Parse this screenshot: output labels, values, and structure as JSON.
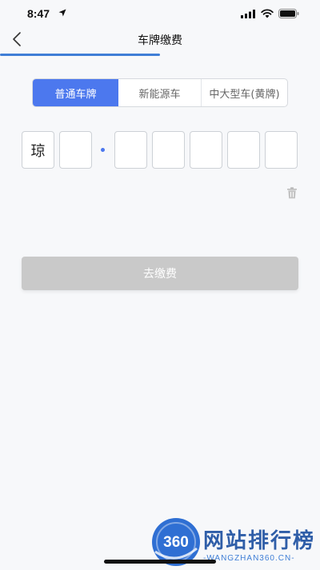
{
  "status_bar": {
    "time": "8:47"
  },
  "nav": {
    "title": "车牌缴费"
  },
  "plate_tabs": [
    {
      "label": "普通车牌",
      "active": true
    },
    {
      "label": "新能源车",
      "active": false
    },
    {
      "label": "中大型车(黄牌)",
      "active": false
    }
  ],
  "plate_chars": [
    "琼",
    "",
    "",
    "",
    "",
    "",
    ""
  ],
  "pay_button": {
    "label": "去缴费"
  },
  "colors": {
    "accent": "#4c78ee",
    "progress": "#3f7ed6",
    "button_disabled": "#c9c9c9",
    "background": "#f7f8fa"
  },
  "watermark": {
    "logo_text": "360",
    "title": "网站排行榜",
    "subtitle": "-WANGZHAN360.CN-"
  }
}
